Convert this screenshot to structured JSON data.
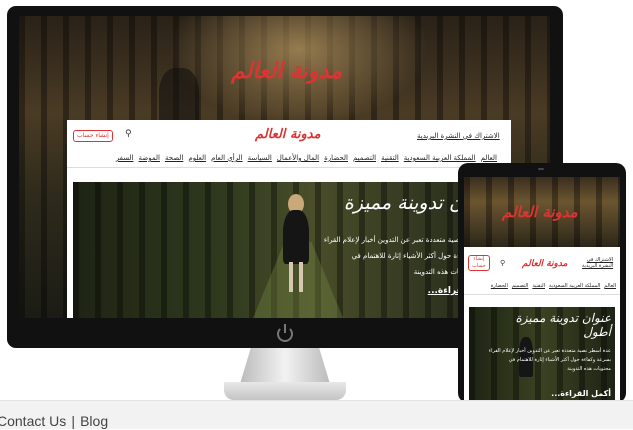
{
  "brand": {
    "logo_text": "مدونة العالم",
    "accent": "#dd3333"
  },
  "header": {
    "register_button": "إنشاء حساب",
    "search_icon": "search-icon",
    "subscribe_link": "الاشتراك في النشرة البريدية"
  },
  "nav": {
    "items": [
      "العالم",
      "المملكة العربية السعودية",
      "التقنية",
      "التصميم",
      "الحضارة",
      "المال والأعمال",
      "السياسة",
      "الرأي العام",
      "العلوم",
      "الصحة",
      "الموضة",
      "السفر"
    ]
  },
  "hero": {
    "title": "عنوان تدوينة مميزة",
    "title_second": "أطول",
    "excerpt_line1": "عدة أسطر نصية متعددة تعبر عن التدوين أخبار لإعلام القراء",
    "excerpt_line2": "بسرعة وكفاءة حول أكثر الأشياء إثارة للاهتمام في",
    "excerpt_line3": "محتويات هذه التدوينة",
    "read_more": "أكمل القراءة..."
  },
  "tablet": {
    "nav_items": [
      "العالم",
      "المملكة العربية السعودية",
      "التقنية",
      "التصميم",
      "الحضارة"
    ],
    "register_button_line1": "إنشاء",
    "register_button_line2": "حساب",
    "subscribe_line1": "الاشتراك في",
    "subscribe_line2": "النشرة البريدية",
    "read_more_partial": "أكمل القراءة..."
  },
  "footer": {
    "contact": "Contact Us",
    "separator": "|",
    "blog": "Blog"
  }
}
